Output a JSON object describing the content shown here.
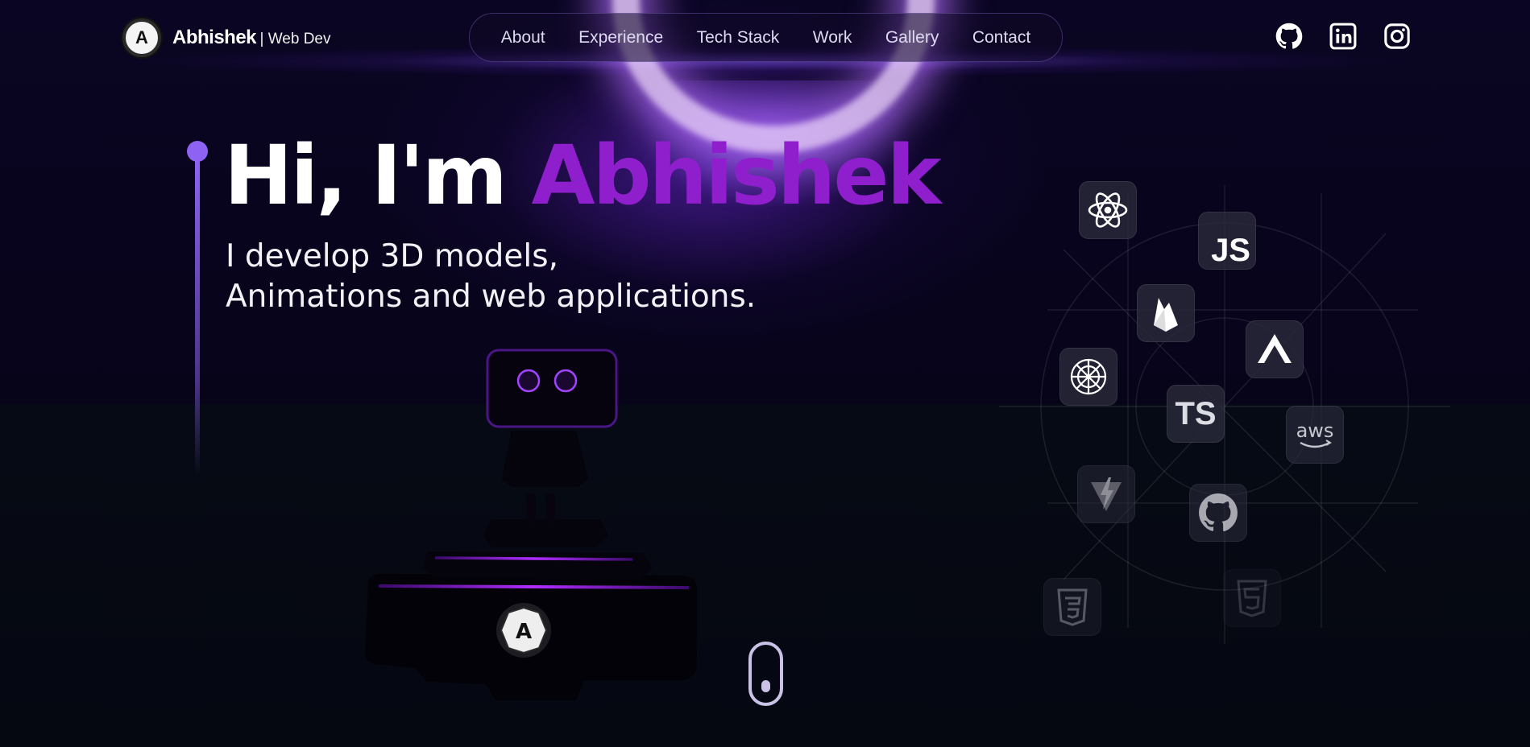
{
  "brand": {
    "logo_letter": "A",
    "name": "Abhishek",
    "subtitle": "| Web Dev"
  },
  "nav": {
    "items": [
      {
        "label": "About"
      },
      {
        "label": "Experience"
      },
      {
        "label": "Tech Stack"
      },
      {
        "label": "Work"
      },
      {
        "label": "Gallery"
      },
      {
        "label": "Contact"
      }
    ]
  },
  "socials": [
    {
      "icon": "github-icon"
    },
    {
      "icon": "linkedin-icon"
    },
    {
      "icon": "instagram-icon"
    }
  ],
  "hero": {
    "greeting": "Hi, I'm ",
    "name": "Abhishek",
    "line1": "I develop 3D models,",
    "line2": "Animations and web applications."
  },
  "robot": {
    "badge_letter": "A"
  },
  "tech_stack": {
    "js_label": "JS",
    "ts_label": "TS",
    "aws_label": "aws",
    "icons": [
      "react-icon",
      "javascript-icon",
      "firebase-icon",
      "vercel-icon",
      "openai-icon",
      "typescript-icon",
      "aws-icon",
      "vite-icon",
      "github-icon",
      "css3-icon",
      "html5-icon"
    ]
  },
  "colors": {
    "accent": "#8f1fcc",
    "timeline": "#8e63f3",
    "background": "#050812"
  }
}
